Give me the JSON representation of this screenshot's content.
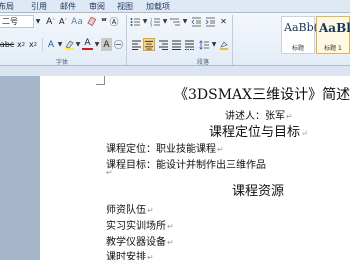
{
  "tabs": [
    "布局",
    "引用",
    "邮件",
    "审阅",
    "视图",
    "加载项"
  ],
  "font": {
    "size_value": "二号"
  },
  "group_labels": {
    "font": "字体",
    "paragraph": "段落"
  },
  "styles": [
    {
      "sample": "AaBb(",
      "name": "标题"
    },
    {
      "sample": "AaBl",
      "name": "标题 1"
    }
  ],
  "document": {
    "title": "《3DSMAX三维设计》简述",
    "author": "讲述人：张军",
    "heading_goal": "课程定位与目标",
    "position_line": "课程定位：职业技能课程",
    "goal_line": "课程目标：能设计并制作出三维作品",
    "heading_resources": "课程资源",
    "items": [
      "师资队伍",
      "实习实训场所",
      "教学仪器设备",
      "课时安排"
    ]
  },
  "marks": {
    "paragraph": "↵"
  }
}
